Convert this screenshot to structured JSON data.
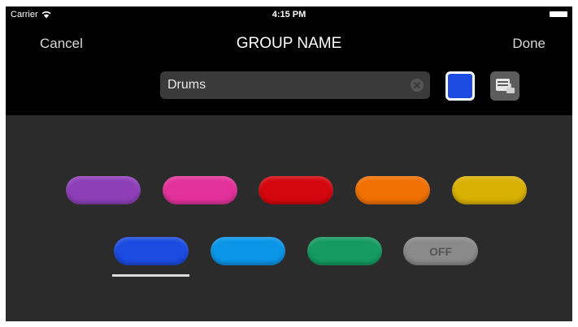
{
  "status_bar": {
    "carrier": "Carrier",
    "time": "4:15 PM"
  },
  "nav": {
    "cancel_label": "Cancel",
    "title": "GROUP NAME",
    "done_label": "Done"
  },
  "name_field": {
    "value": "Drums"
  },
  "selected_color": "#1b4be0",
  "colors": {
    "row1": [
      {
        "name": "purple",
        "hex": "#8e3fb8"
      },
      {
        "name": "pink",
        "hex": "#e2329a"
      },
      {
        "name": "red",
        "hex": "#d4060e"
      },
      {
        "name": "orange",
        "hex": "#f07004"
      },
      {
        "name": "yellow",
        "hex": "#d9b004"
      }
    ],
    "row2": [
      {
        "name": "blue",
        "hex": "#1b4be0",
        "selected": true
      },
      {
        "name": "light-blue",
        "hex": "#0a95e8"
      },
      {
        "name": "green",
        "hex": "#159a62"
      },
      {
        "name": "off",
        "hex": "#8a8a8a",
        "label": "OFF"
      }
    ]
  }
}
